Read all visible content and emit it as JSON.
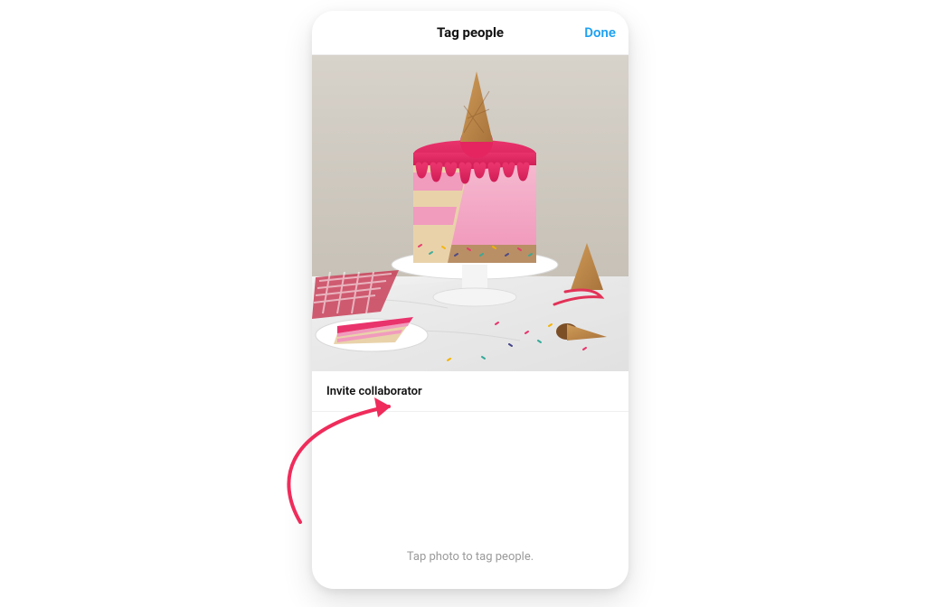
{
  "header": {
    "title": "Tag people",
    "done_label": "Done"
  },
  "invite": {
    "label": "Invite collaborator"
  },
  "hint": {
    "text": "Tap photo to tag people."
  },
  "colors": {
    "accent": "#1ea1f2",
    "annotation": "#ef2c5b"
  }
}
